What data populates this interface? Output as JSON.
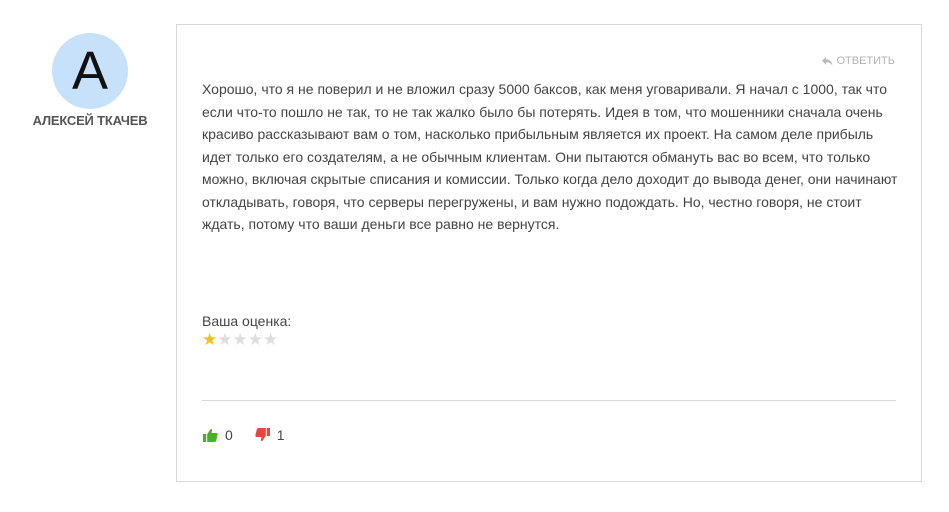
{
  "author": {
    "avatar_letter": "A",
    "name": "АЛЕКСЕЙ ТКАЧЕВ"
  },
  "comment": {
    "reply_label": "ОТВЕТИТЬ",
    "text": "Хорошо, что я не поверил и не вложил сразу 5000 баксов, как меня уговаривали. Я начал с 1000, так что если что-то пошло не так, то не так жалко было бы потерять. Идея в том, что мошенники сначала очень красиво рассказывают вам о том, насколько прибыльным является их проект. На самом деле прибыль идет только его создателям, а не обычным клиентам. Они пытаются обмануть вас во всем, что только можно, включая скрытые списания и комиссии. Только когда дело доходит до вывода денег, они начинают откладывать, говоря, что серверы перегружены, и вам нужно подождать. Но, честно говоря, не стоит ждать, потому что ваши деньги все равно не вернутся.",
    "rating_label": "Ваша оценка:",
    "rating": 1,
    "rating_max": 5,
    "likes": "0",
    "dislikes": "1"
  },
  "colors": {
    "avatar_bg": "#c8e1fb",
    "star_on": "#f4c01b",
    "star_off": "#dedede",
    "like": "#4caf28",
    "dislike": "#e8453c"
  },
  "icons": {
    "reply": "reply-arrow-icon",
    "like": "thumbs-up-icon",
    "dislike": "thumbs-down-icon",
    "star": "star-icon"
  }
}
